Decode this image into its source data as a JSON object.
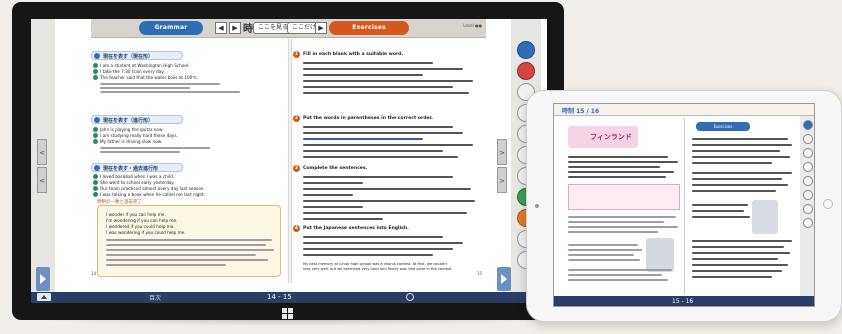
{
  "windows_tablet": {
    "header": {
      "grammar_label": "Grammar",
      "title": "時制",
      "title_num": "3",
      "exercises_label": "Exercises",
      "btn_prev": "◀",
      "btn_play": "▶",
      "pill_1": "ここを見る",
      "pill_2": "ここだけ",
      "level": "Level ●●"
    },
    "left_page": {
      "section_1": "現在を表す（現在形）",
      "lines_1": [
        "I am a student at Washington High School.",
        "I take the 7:30 train every day.",
        "The teacher said that the water boils at 100℃."
      ],
      "section_2": "現在を表す（進行形）",
      "lines_2": [
        "John is playing the guitar now.",
        "I am studying really hard these days.",
        "My father is driving slow now."
      ],
      "section_3": "現在を表す・過去進行形",
      "lines_3": [
        "I loved baseball when I was a child.",
        "She went to school early yesterday.",
        "Our team practiced almost every day last season.",
        "I was talking a book when he called me last night."
      ],
      "box_label": "時制の一致と過去完了",
      "box_lines": [
        "I wonder if you can help me.",
        "I'm wondering if you can help me.",
        "I wondered if you could help me.",
        "I was wondering if you could help me."
      ],
      "page_note": "14"
    },
    "right_page": {
      "q1_num": "1",
      "q1": "Fill in each blank with a suitable word.",
      "q2_num": "2",
      "q2": "Put the words in parentheses in the correct order.",
      "q3_num": "3",
      "q3": "Complete the sentences.",
      "q4_num": "4",
      "q4": "Put the Japanese sentences into English.",
      "last_line_1": "My best memory at junior high school was a chorus contest. At first, we couldn't",
      "last_line_2": "sing very well, but we practiced very hard and finally won first prize in the contest.",
      "page_note": "15"
    },
    "bottom_bar": {
      "page_range": "14 - 15",
      "left_label": "目次"
    },
    "toolbar": {
      "tools": [
        "cursor-icon",
        "pen-icon",
        "marker-icon",
        "eraser-icon",
        "ruler-icon",
        "hand-icon",
        "zoom-icon",
        "text-icon",
        "sticky-icon",
        "undo-icon"
      ]
    },
    "nav": {
      "prev": "<",
      "next": ">"
    }
  },
  "ipad": {
    "top_label": "時制 15 / 16",
    "title_word": "フィンランド",
    "right_header": "Exercises",
    "bottom_range": "15 - 16"
  },
  "colors": {
    "grammar_blue": "#2f6eb5",
    "exercise_orange": "#d4581f",
    "bar_navy": "#2b3d67"
  }
}
